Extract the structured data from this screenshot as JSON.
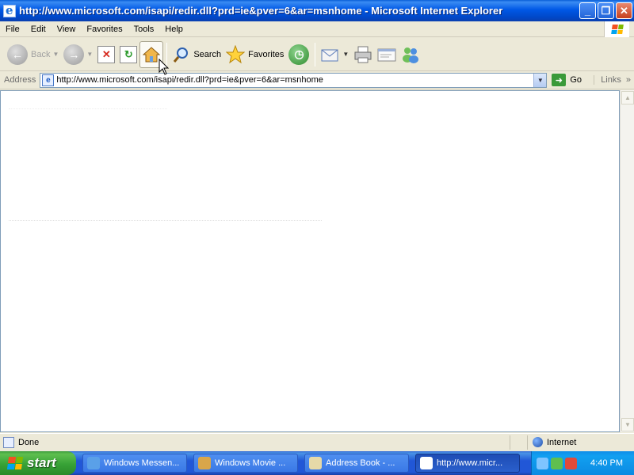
{
  "window": {
    "title": "http://www.microsoft.com/isapi/redir.dll?prd=ie&pver=6&ar=msnhome - Microsoft Internet Explorer",
    "buttons": [
      "minimize-button",
      "maximize-button",
      "close-button"
    ]
  },
  "menu": {
    "items": [
      {
        "label": "File"
      },
      {
        "label": "Edit"
      },
      {
        "label": "View"
      },
      {
        "label": "Favorites"
      },
      {
        "label": "Tools"
      },
      {
        "label": "Help"
      }
    ]
  },
  "toolbar": {
    "back_label": "Back",
    "search_label": "Search",
    "favorites_label": "Favorites",
    "icons": [
      "back-icon",
      "forward-icon",
      "stop-icon",
      "refresh-icon",
      "home-icon",
      "search-icon",
      "favorites-star-icon",
      "history-icon",
      "mail-icon",
      "print-icon",
      "edit-icon",
      "messenger-icon"
    ]
  },
  "address": {
    "label": "Address",
    "url": "http://www.microsoft.com/isapi/redir.dll?prd=ie&pver=6&ar=msnhome",
    "go_label": "Go",
    "links_label": "Links",
    "links_more": "»"
  },
  "status": {
    "text": "Done",
    "zone": "Internet"
  },
  "taskbar": {
    "start_label": "start",
    "tasks": [
      {
        "label": "Windows Messen...",
        "icon": "messenger-icon",
        "icon_color": "#5aa0e8"
      },
      {
        "label": "Windows Movie ...",
        "icon": "movie-maker-icon",
        "icon_color": "#d9a64a"
      },
      {
        "label": "Address Book - ...",
        "icon": "address-book-icon",
        "icon_color": "#e6d9a8"
      },
      {
        "label": "http://www.micr...",
        "icon": "ie-icon",
        "icon_color": "#ffffff"
      }
    ],
    "clock": "4:40 PM",
    "tray_icons": [
      "network-icon",
      "shield-icon",
      "security-alert-icon"
    ]
  },
  "colors": {
    "titlebar": "#0058e6",
    "taskbar": "#2157d7",
    "start": "#37a236",
    "chrome": "#ece9d8"
  }
}
